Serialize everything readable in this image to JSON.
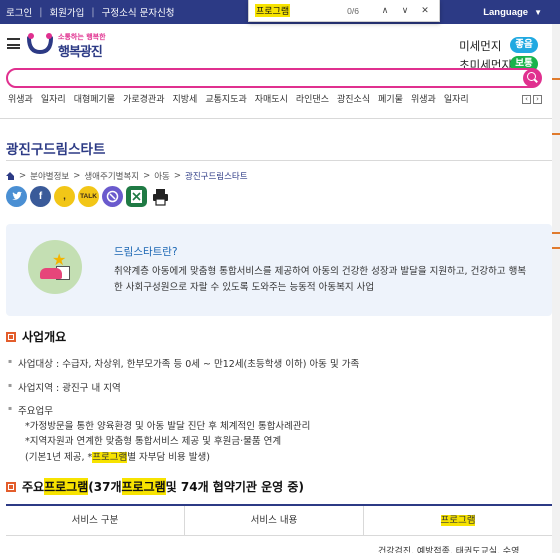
{
  "topbar": {
    "links": [
      "로그인",
      "회원가입",
      "구정소식 문자신청"
    ],
    "language": "Language"
  },
  "findbar": {
    "query": "프로그램",
    "count": "0/6",
    "up_icon": "chevron-up-icon",
    "down_icon": "chevron-down-icon",
    "close_icon": "close-icon"
  },
  "header": {
    "logo_tagline": "소통하는 행복한",
    "logo_name": "행복광진",
    "fine_dust_label": "미세먼지",
    "fine_dust_status": "좋음",
    "ultrafine_dust_label": "초미세먼지",
    "ultrafine_dust_status": "보통"
  },
  "search": {
    "placeholder": ""
  },
  "keywords": [
    "위생과",
    "일자리",
    "대형폐기물",
    "가로경관과",
    "지방세",
    "교통지도과",
    "자매도시",
    "라인댄스",
    "광진소식",
    "폐기물",
    "위생과",
    "일자리"
  ],
  "page": {
    "title": "광진구드림스타트",
    "breadcrumb": [
      "분야별정보",
      "생애주기별복지",
      "아동",
      "광진구드림스타트"
    ]
  },
  "share": {
    "icons": [
      "twitter-icon",
      "facebook-icon",
      "kakaostory-icon",
      "kakaotalk-icon",
      "band-icon",
      "excel-icon",
      "print-icon"
    ],
    "kakaotalk_text": "TALK"
  },
  "intro": {
    "heading": "드림스타트란?",
    "body": "취약계층 아동에게 맞춤형 통합서비스를 제공하여 아동의 건강한 성장과 발달을 지원하고, 건강하고 행복한 사회구성원으로 자랄 수 있도록 도와주는 능동적 아동복지 사업"
  },
  "overview": {
    "heading": "사업개요",
    "target": "사업대상 : 수급자, 차상위, 한부모가족 등 0세 ~ 만12세(초등학생 이하) 아동 및 가족",
    "area": "사업지역 : 광진구 내 지역",
    "tasks_label": "주요업무",
    "tasks": [
      "*가정방문을 통한 양육환경 및 아동 발달 진단 후 체계적인 통합사례관리",
      "*지역자원과 연계한 맞춤형 통합서비스 제공 및 후원금·물품 연계"
    ],
    "note_prefix": "(기본1년 제공, *",
    "note_highlight": "프로그램",
    "note_suffix": "별 자부담 비용 발생)"
  },
  "programs": {
    "heading_prefix": "주요 ",
    "heading_hl1": "프로그램",
    "heading_mid": "(37개 ",
    "heading_hl2": "프로그램",
    "heading_suffix": " 및 74개 협약기관 운영 중)"
  },
  "table": {
    "headers": [
      "서비스 구분",
      "서비스 내용",
      "프로그램"
    ],
    "first_row_partial": "건강검진, 예방접종, 태권도교실, 수영"
  }
}
